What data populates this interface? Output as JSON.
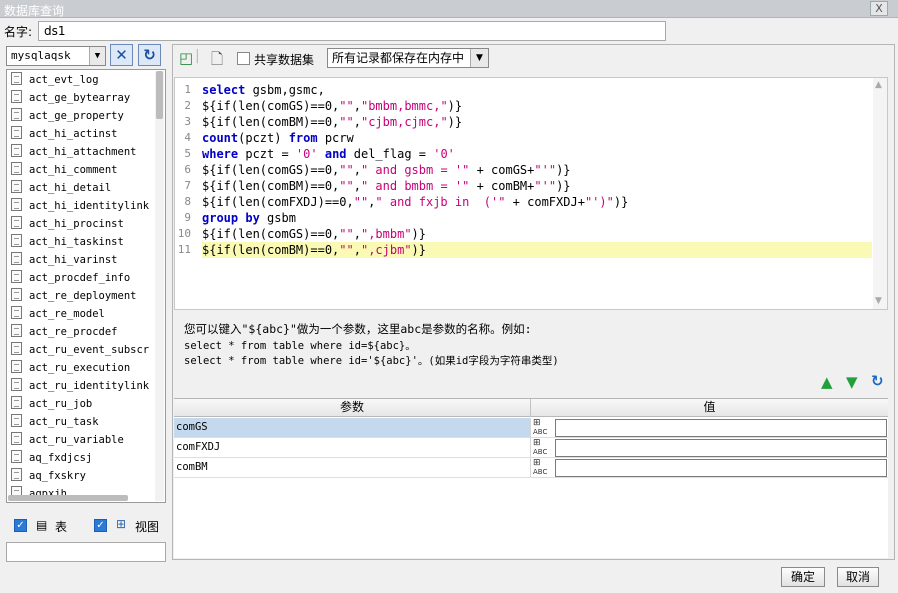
{
  "window": {
    "title": "数据库查询",
    "close_glyph": "X"
  },
  "name_field": {
    "label": "名字:",
    "value": "ds1"
  },
  "left": {
    "db_selected": "mysqlaqsk",
    "tables": [
      "act_evt_log",
      "act_ge_bytearray",
      "act_ge_property",
      "act_hi_actinst",
      "act_hi_attachment",
      "act_hi_comment",
      "act_hi_detail",
      "act_hi_identitylink",
      "act_hi_procinst",
      "act_hi_taskinst",
      "act_hi_varinst",
      "act_procdef_info",
      "act_re_deployment",
      "act_re_model",
      "act_re_procdef",
      "act_ru_event_subscr",
      "act_ru_execution",
      "act_ru_identitylink",
      "act_ru_job",
      "act_ru_task",
      "act_ru_variable",
      "aq_fxdjcsj",
      "aq_fxskry",
      "aqpxjh"
    ],
    "opt_table_label": "表",
    "opt_view_label": "视图",
    "opt_table_checked": true,
    "opt_view_checked": true,
    "filter_value": ""
  },
  "toolbar": {
    "share_label": "共享数据集",
    "share_checked": false,
    "memory_option": "所有记录都保存在内存中"
  },
  "editor": {
    "lines": [
      {
        "n": "1",
        "parts": [
          [
            "kw",
            "select"
          ],
          [
            "pl",
            " gsbm,gsmc,"
          ]
        ]
      },
      {
        "n": "2",
        "parts": [
          [
            "pl",
            "${if(len(comGS)==0,"
          ],
          [
            "str",
            "\"\""
          ],
          [
            "pl",
            ","
          ],
          [
            "str",
            "\"bmbm,bmmc,\""
          ],
          [
            "pl",
            ")}"
          ]
        ]
      },
      {
        "n": "3",
        "parts": [
          [
            "pl",
            "${if(len(comBM)==0,"
          ],
          [
            "str",
            "\"\""
          ],
          [
            "pl",
            ","
          ],
          [
            "str",
            "\"cjbm,cjmc,\""
          ],
          [
            "pl",
            ")}"
          ]
        ]
      },
      {
        "n": "4",
        "parts": [
          [
            "kw",
            "count"
          ],
          [
            "pl",
            "(pczt) "
          ],
          [
            "kw",
            "from"
          ],
          [
            "pl",
            " pcrw"
          ]
        ]
      },
      {
        "n": "5",
        "parts": [
          [
            "kw",
            "where"
          ],
          [
            "pl",
            " pczt = "
          ],
          [
            "str",
            "'0'"
          ],
          [
            "pl",
            " "
          ],
          [
            "kw",
            "and"
          ],
          [
            "pl",
            " del_flag = "
          ],
          [
            "str",
            "'0'"
          ]
        ]
      },
      {
        "n": "6",
        "parts": [
          [
            "pl",
            "${if(len(comGS)==0,"
          ],
          [
            "str",
            "\"\""
          ],
          [
            "pl",
            ","
          ],
          [
            "str",
            "\" and gsbm = '\""
          ],
          [
            "pl",
            " + comGS+"
          ],
          [
            "str",
            "\"'\""
          ],
          [
            "pl",
            ")}"
          ]
        ]
      },
      {
        "n": "7",
        "parts": [
          [
            "pl",
            "${if(len(comBM)==0,"
          ],
          [
            "str",
            "\"\""
          ],
          [
            "pl",
            ","
          ],
          [
            "str",
            "\" and bmbm = '\""
          ],
          [
            "pl",
            " + comBM+"
          ],
          [
            "str",
            "\"'\""
          ],
          [
            "pl",
            ")}"
          ]
        ]
      },
      {
        "n": "8",
        "parts": [
          [
            "pl",
            "${if(len(comFXDJ)==0,"
          ],
          [
            "str",
            "\"\""
          ],
          [
            "pl",
            ","
          ],
          [
            "str",
            "\" and fxjb in  ('\""
          ],
          [
            "pl",
            " + comFXDJ+"
          ],
          [
            "str",
            "\"')\""
          ],
          [
            "pl",
            ")}"
          ]
        ]
      },
      {
        "n": "9",
        "parts": [
          [
            "kw",
            "group by"
          ],
          [
            "pl",
            " gsbm"
          ]
        ]
      },
      {
        "n": "10",
        "parts": [
          [
            "pl",
            "${if(len(comGS)==0,"
          ],
          [
            "str",
            "\"\""
          ],
          [
            "pl",
            ","
          ],
          [
            "str",
            "\",bmbm\""
          ],
          [
            "pl",
            ")}"
          ]
        ]
      },
      {
        "n": "11",
        "parts": [
          [
            "pl",
            "${if(len(comBM)==0,"
          ],
          [
            "str",
            "\"\""
          ],
          [
            "pl",
            ","
          ],
          [
            "str",
            "\",cjbm\""
          ],
          [
            "pl",
            ")}"
          ]
        ]
      }
    ],
    "highlight_line": 11
  },
  "hint": {
    "line1": "您可以键入\"${abc}\"做为一个参数，这里abc是参数的名称。例如:",
    "line2": "select * from table where id=${abc}。",
    "line3": "select * from table where id='${abc}'。(如果id字段为字符串类型)"
  },
  "params": {
    "col_name": "参数",
    "col_value": "值",
    "rows": [
      {
        "name": "comGS",
        "value": ""
      },
      {
        "name": "comFXDJ",
        "value": ""
      },
      {
        "name": "comBM",
        "value": ""
      }
    ],
    "selected_row": 0,
    "type_badge": "ABC"
  },
  "buttons": {
    "ok": "确定",
    "cancel": "取消"
  },
  "icons": {
    "connect": "tools-icon",
    "refresh": "refresh-icon",
    "preview": "preview-icon",
    "new": "new-file-icon",
    "up": "move-up-icon",
    "down": "move-down-icon",
    "reload": "refresh-params-icon"
  },
  "colors": {
    "keyword": "#0000c8",
    "string": "#c8007a",
    "highlight": "#fafab4",
    "selection": "#c5d9ee",
    "arrow": "#22a03c"
  }
}
